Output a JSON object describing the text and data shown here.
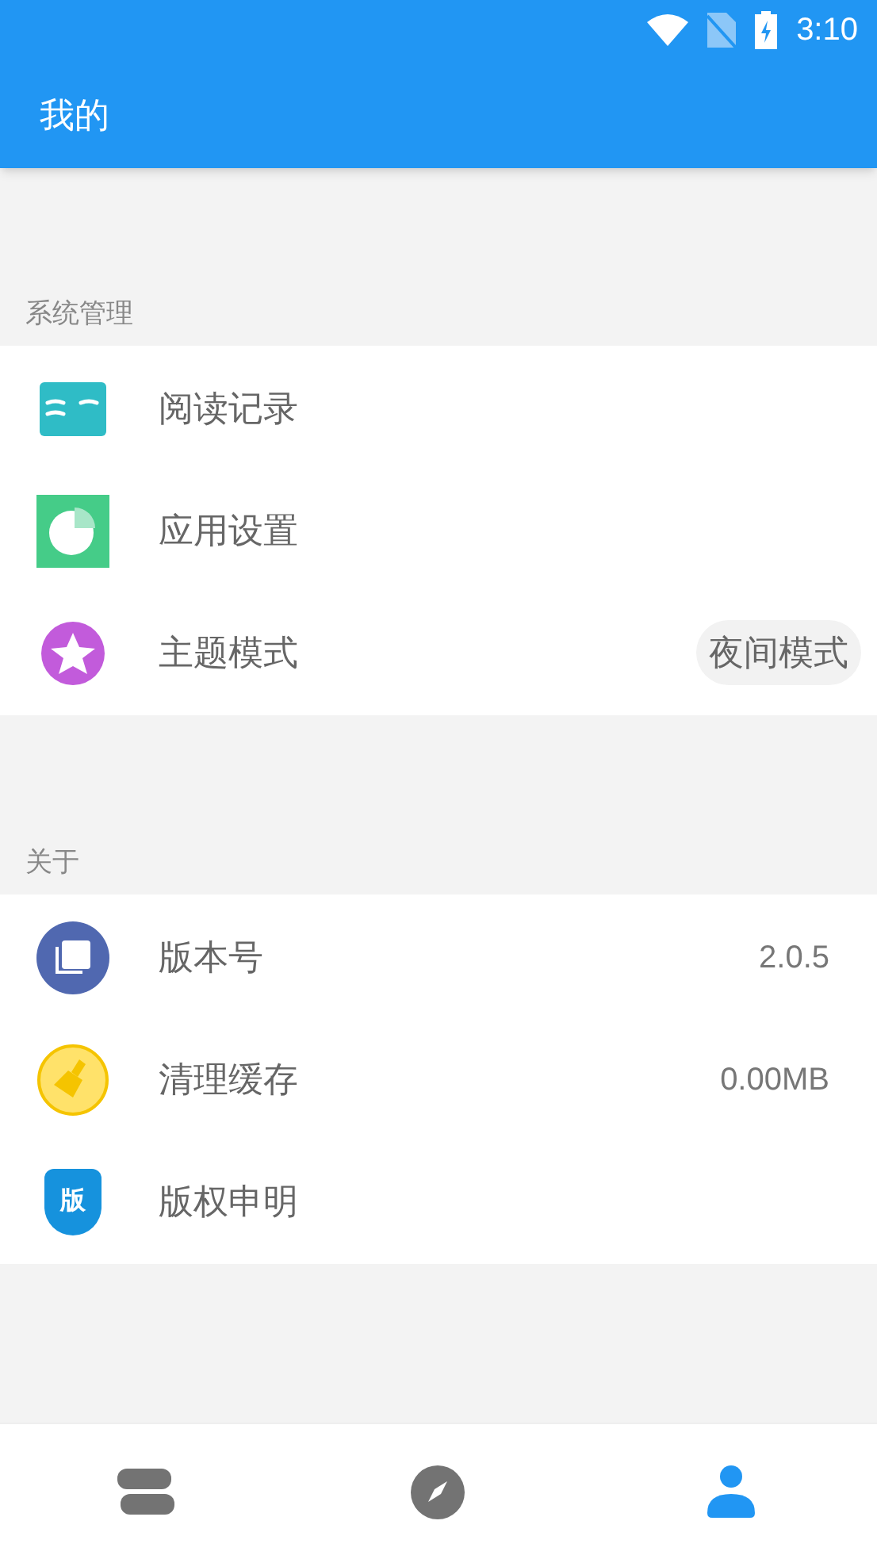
{
  "status_bar": {
    "time": "3:10"
  },
  "app_bar": {
    "title": "我的"
  },
  "sections": [
    {
      "title": "系统管理",
      "items": [
        {
          "kind": "book",
          "label": "阅读记录"
        },
        {
          "kind": "chart",
          "label": "应用设置"
        },
        {
          "kind": "star",
          "label": "主题模式",
          "chip": "夜间模式"
        }
      ]
    },
    {
      "title": "关于",
      "items": [
        {
          "kind": "layers",
          "label": "版本号",
          "value": "2.0.5"
        },
        {
          "kind": "broom",
          "label": "清理缓存",
          "value": "0.00MB"
        },
        {
          "kind": "shield",
          "label": "版权申明",
          "icon_text": "版"
        }
      ]
    }
  ],
  "bottom_nav": [
    {
      "kind": "books",
      "selected": false
    },
    {
      "kind": "compass",
      "selected": false
    },
    {
      "kind": "person",
      "selected": true
    }
  ]
}
